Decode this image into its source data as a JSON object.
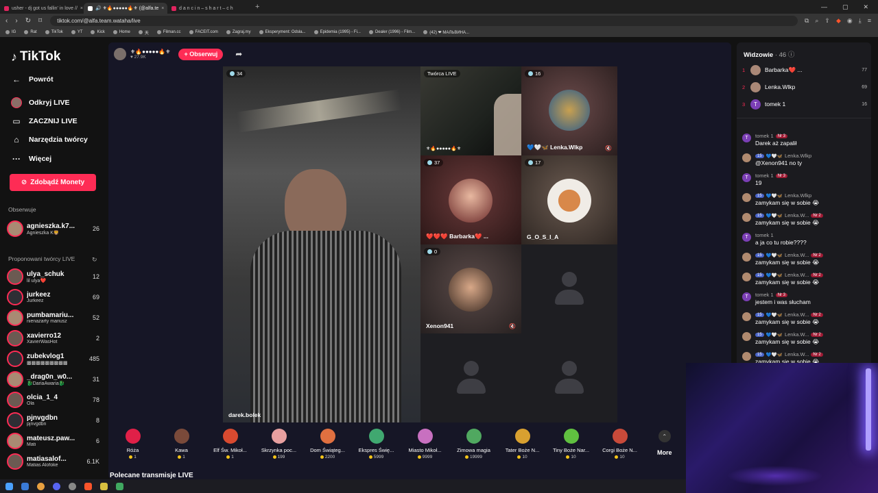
{
  "browser": {
    "tabs": [
      {
        "label": "usher - dj got us fallin' in love //",
        "active": false
      },
      {
        "label": "🔊 ⚜🔥●●●●●🔥⚜ (@alfa.te",
        "active": true
      },
      {
        "label": "d a n c i n – s h a r t – c h",
        "active": false
      }
    ],
    "url": "tiktok.com/@alfa.team.wataha/live",
    "bookmarks": [
      "IG",
      "Rat",
      "TikTok",
      "YT",
      "Kick",
      "Home",
      "天",
      "Filman.cc",
      "FACEIT.com",
      "Zagraj.my",
      "Eksperyment: Odsła...",
      "Epidemia (1995) - Fi...",
      "Dealer (1996) - Film...",
      "(42) ❤ МАЛЬВИНА..."
    ]
  },
  "sidebar": {
    "logo": "TikTok",
    "back": "Powrót",
    "nav": [
      {
        "label": "Odkryj LIVE",
        "icon": "live-discover-icon"
      },
      {
        "label": "ZACZNIJ LIVE",
        "icon": "camera-icon"
      },
      {
        "label": "Narzędzia twórcy",
        "icon": "creator-tools-icon"
      },
      {
        "label": "Więcej",
        "icon": "more-dots-icon"
      }
    ],
    "coins_button": "Zdobądź Monety",
    "following_title": "Obserwuje",
    "following": [
      {
        "name": "agnieszka.k7...",
        "sub": "Agnieszka K🦁",
        "count": "26"
      }
    ],
    "suggested_title": "Proponowani twórcy LIVE",
    "suggested": [
      {
        "name": "ulya_schuk",
        "sub": "lil ulya❤️",
        "count": "12"
      },
      {
        "name": "jurkeez",
        "sub": "Jurkeez",
        "count": "69"
      },
      {
        "name": "pumbamariu...",
        "sub": "nienażarty mariusz",
        "count": "52"
      },
      {
        "name": "xavierro12",
        "sub": "XavierWasHot",
        "count": "2"
      },
      {
        "name": "zubekvlog1",
        "sub": "▩▩▩▩▩▩▩▩▩",
        "count": "485"
      },
      {
        "name": "_drag0n_w0...",
        "sub": "🐉DariaAwaria🐉",
        "count": "31"
      },
      {
        "name": "olcia_1_4",
        "sub": "Ola",
        "count": "78"
      },
      {
        "name": "pjnvgdbn",
        "sub": "pjnvgdbn",
        "count": "8"
      },
      {
        "name": "mateusz.paw...",
        "sub": "Mati",
        "count": "6"
      },
      {
        "name": "matiasalof...",
        "sub": "Matias  Alofoke",
        "count": "6.1K"
      }
    ]
  },
  "host": {
    "name": "⚜🔥●●●●●🔥⚜",
    "likes": "27.9K",
    "follow_label": "+ Obserwuj"
  },
  "stage": {
    "main_name": "darek.bolek",
    "main_viewers": "34",
    "creator_badge": "Twórca LIVE",
    "creator_cell_name": "⚜🔥●●●●●🔥⚜",
    "guests": [
      {
        "name": "💙🤍🦋 Lenka.Wlkp",
        "count": "16"
      },
      {
        "name": "❤️❤️❤️ Barbarka❤️ ...",
        "count": "37"
      },
      {
        "name": "G_O_S_I_A",
        "count": "17"
      },
      {
        "name": "Xenon941",
        "count": "0"
      }
    ]
  },
  "gifts": [
    {
      "name": "Róża",
      "price": "1"
    },
    {
      "name": "Kawa",
      "price": "1"
    },
    {
      "name": "Elf Św. Mikoł...",
      "price": "1"
    },
    {
      "name": "Skrzynka poc...",
      "price": "199"
    },
    {
      "name": "Dom Świąteg...",
      "price": "2200"
    },
    {
      "name": "Ekspres Świę...",
      "price": "5999"
    },
    {
      "name": "Miasto Mikoł...",
      "price": "9999"
    },
    {
      "name": "Zimowa magia",
      "price": "19999"
    },
    {
      "name": "Tater Boże N...",
      "price": "10"
    },
    {
      "name": "Tiny Boże Nar...",
      "price": "10"
    },
    {
      "name": "Corgi Boże N...",
      "price": "10"
    }
  ],
  "gifts_more": "More",
  "recommended_title": "Polecane transmisje LIVE",
  "chat": {
    "viewers_title": "Widzowie",
    "viewers_count": "· 46",
    "top_viewers": [
      {
        "rank": "1",
        "name": "Barbarka❤️ ...",
        "score": "77"
      },
      {
        "rank": "2",
        "name": "Lenka.Wlkp",
        "score": "69"
      },
      {
        "rank": "3",
        "name": "tomek 1",
        "score": "16"
      }
    ],
    "messages": [
      {
        "user": "tomek 1",
        "badge": "Nr 3",
        "text": "Darek aż zapalił",
        "type": "t"
      },
      {
        "user": "Lenka.Wlkp",
        "level": "15",
        "text": "@Xenon941 no ty",
        "type": "l"
      },
      {
        "user": "tomek 1",
        "badge": "Nr 3",
        "text": "19",
        "type": "t"
      },
      {
        "user": "Lenka.Wlkp",
        "level": "15",
        "text": "zamykam się w sobie 😭",
        "type": "l"
      },
      {
        "user": "Lenka.W...",
        "level": "15",
        "badge": "Nr 2",
        "text": "zamykam się w sobie 😭",
        "type": "l"
      },
      {
        "user": "tomek 1",
        "text": "a ja co tu robie????",
        "type": "t"
      },
      {
        "user": "Lenka.W...",
        "level": "15",
        "badge": "Nr 2",
        "text": "zamykam się w sobie 😭",
        "type": "l"
      },
      {
        "user": "Lenka.W...",
        "level": "15",
        "badge": "Nr 2",
        "text": "zamykam się w sobie 😭",
        "type": "l"
      },
      {
        "user": "tomek 1",
        "badge": "Nr 3",
        "text": "jestem i was słucham",
        "type": "t"
      },
      {
        "user": "Lenka.W...",
        "level": "15",
        "badge": "Nr 2",
        "text": "zamykam się w sobie 😭",
        "type": "l"
      },
      {
        "user": "Lenka.W...",
        "level": "15",
        "badge": "Nr 2",
        "text": "zamykam się w sobie 😭",
        "type": "l"
      },
      {
        "user": "Lenka.W...",
        "level": "15",
        "badge": "Nr 2",
        "text": "zamykam się w sobie 😭",
        "type": "l"
      }
    ]
  },
  "colors": {
    "accent": "#fe2c55",
    "background": "#121212",
    "panel": "#1b1b1f"
  }
}
